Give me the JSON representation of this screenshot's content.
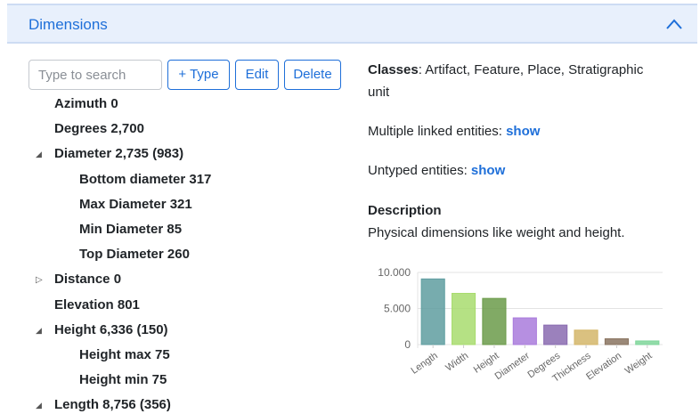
{
  "panel": {
    "title": "Dimensions"
  },
  "toolbar": {
    "search_placeholder": "Type to search",
    "add_type_label": "+ Type",
    "edit_label": "Edit",
    "delete_label": "Delete"
  },
  "tree": [
    {
      "label": "Azimuth 0",
      "level": 0,
      "caret": ""
    },
    {
      "label": "Degrees 2,700",
      "level": 0,
      "caret": ""
    },
    {
      "label": "Diameter 2,735 (983)",
      "level": 0,
      "caret": "expanded"
    },
    {
      "label": "Bottom diameter 317",
      "level": 1,
      "caret": ""
    },
    {
      "label": "Max Diameter 321",
      "level": 1,
      "caret": ""
    },
    {
      "label": "Min Diameter 85",
      "level": 1,
      "caret": ""
    },
    {
      "label": "Top Diameter 260",
      "level": 1,
      "caret": ""
    },
    {
      "label": "Distance 0",
      "level": 0,
      "caret": "collapsed"
    },
    {
      "label": "Elevation 801",
      "level": 0,
      "caret": ""
    },
    {
      "label": "Height 6,336 (150)",
      "level": 0,
      "caret": "expanded"
    },
    {
      "label": "Height max 75",
      "level": 1,
      "caret": ""
    },
    {
      "label": "Height min 75",
      "level": 1,
      "caret": ""
    },
    {
      "label": "Length 8,756 (356)",
      "level": 0,
      "caret": "expanded"
    }
  ],
  "info": {
    "classes_label": "Classes",
    "classes_line1": ": Artifact, Feature, Place, Stratigraphic",
    "classes_line2": "unit",
    "linked_label": "Multiple linked entities: ",
    "linked_link": "show",
    "untyped_label": "Untyped entities: ",
    "untyped_link": "show",
    "description_heading": "Description",
    "description_text": "Physical dimensions like weight and height."
  },
  "chart_data": {
    "type": "bar",
    "categories": [
      "Length",
      "Width",
      "Height",
      "Diameter",
      "Degrees",
      "Thickness",
      "Elevation",
      "Weight"
    ],
    "values": [
      9100,
      7100,
      6400,
      3700,
      2700,
      2000,
      800,
      500
    ],
    "colors": [
      "#5f9ea0",
      "#a8dc6e",
      "#6b9b4a",
      "#a97bdc",
      "#8a6bb0",
      "#d4b66a",
      "#8a7460",
      "#7fd69a"
    ],
    "yticks": [
      "10.000",
      "5.000",
      "0"
    ],
    "ytick_values": [
      10000,
      5000,
      0
    ],
    "ylim": [
      0,
      10000
    ]
  }
}
